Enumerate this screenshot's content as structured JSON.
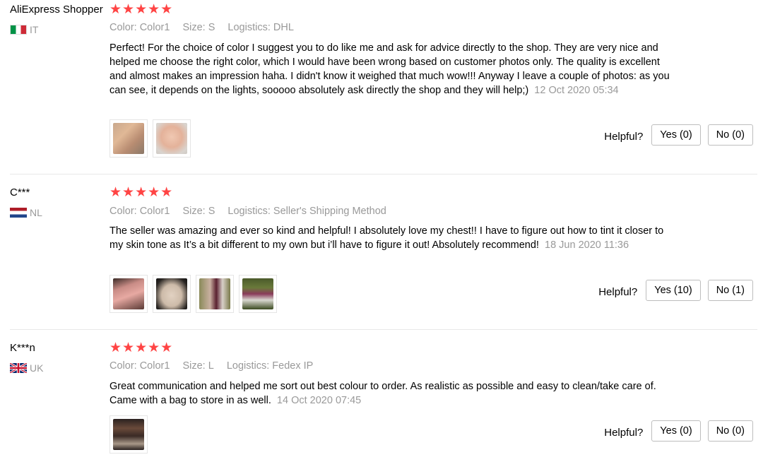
{
  "reviews": [
    {
      "user": "AliExpress Shopper",
      "country": "IT",
      "rating": 5,
      "stars": "★★★★★",
      "color": "Color: Color1",
      "size": "Size: S",
      "logistics": "Logistics: DHL",
      "text": "Perfect! For the choice of color I suggest you to do like me and ask for advice directly to the shop. They are very nice and helped me choose the right color, which I would have been wrong based on customer photos only. The quality is excellent and almost makes an impression haha. I didn't know it weighed that much wow!!! Anyway I leave a couple of photos: as you can see, it depends on the lights, sooooo absolutely ask directly the shop and they will help;)",
      "date": "12 Oct 2020 05:34",
      "helpful_label": "Helpful?",
      "yes_label": "Yes (0)",
      "no_label": "No (0)"
    },
    {
      "user": "C***",
      "country": "NL",
      "rating": 5,
      "stars": "★★★★★",
      "color": "Color: Color1",
      "size": "Size: S",
      "logistics": "Logistics: Seller's Shipping Method",
      "text": "The seller was amazing and ever so kind and helpful! I absolutely love my chest!! I have to figure out how to tint it closer to my skin tone as It’s a bit different to my own but i’ll have to figure it out! Absolutely recommend!",
      "date": "18 Jun 2020 11:36",
      "helpful_label": "Helpful?",
      "yes_label": "Yes (10)",
      "no_label": "No (1)"
    },
    {
      "user": "K***n",
      "country": "UK",
      "rating": 5,
      "stars": "★★★★★",
      "color": "Color: Color1",
      "size": "Size: L",
      "logistics": "Logistics: Fedex IP",
      "text": "Great communication and helped me sort out best colour to order. As realistic as possible and easy to clean/take care of. Came with a bag to store in as well.",
      "date": "14 Oct 2020 07:45",
      "helpful_label": "Helpful?",
      "yes_label": "Yes (0)",
      "no_label": "No (0)"
    }
  ]
}
